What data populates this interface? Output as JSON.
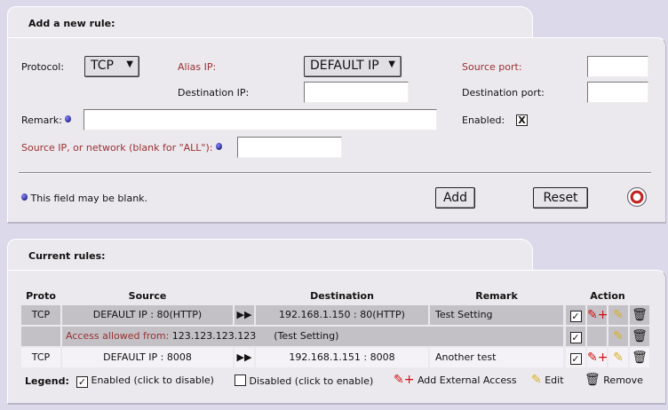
{
  "add_rule": {
    "title": "Add a new rule:",
    "protocol_label": "Protocol:",
    "protocol_value": "TCP",
    "alias_ip_label": "Alias IP:",
    "alias_ip_value": "DEFAULT IP",
    "destination_ip_label": "Destination IP:",
    "destination_ip_value": "",
    "source_port_label": "Source port:",
    "source_port_value": "",
    "destination_port_label": "Destination port:",
    "destination_port_value": "",
    "remark_label": "Remark:",
    "remark_value": "",
    "enabled_label": "Enabled:",
    "enabled_mark": "X",
    "source_ip_label": "Source IP, or network (blank for \"ALL\"):",
    "source_ip_value": "",
    "blank_note": "This field may be blank.",
    "add_button": "Add",
    "reset_button": "Reset"
  },
  "current_rules": {
    "title": "Current rules:",
    "headers": {
      "proto": "Proto",
      "source": "Source",
      "destination": "Destination",
      "remark": "Remark",
      "action": "Action"
    },
    "rows": [
      {
        "proto": "TCP",
        "source": "DEFAULT IP : 80(HTTP)",
        "destination": "192.168.1.150 : 80(HTTP)",
        "remark": "Test Setting"
      },
      {
        "access_label": "Access allowed from:",
        "access_ip": "123.123.123.123",
        "access_remark": "(Test Setting)"
      },
      {
        "proto": "TCP",
        "source": "DEFAULT IP : 8008",
        "destination": "192.168.1.151 : 8008",
        "remark": "Another test"
      }
    ],
    "legend": {
      "label": "Legend:",
      "enabled": "Enabled (click to disable)",
      "disabled": "Disabled (click to enable)",
      "add_external": "Add External Access",
      "edit": "Edit",
      "remove": "Remove"
    },
    "check_mark": "✓"
  }
}
